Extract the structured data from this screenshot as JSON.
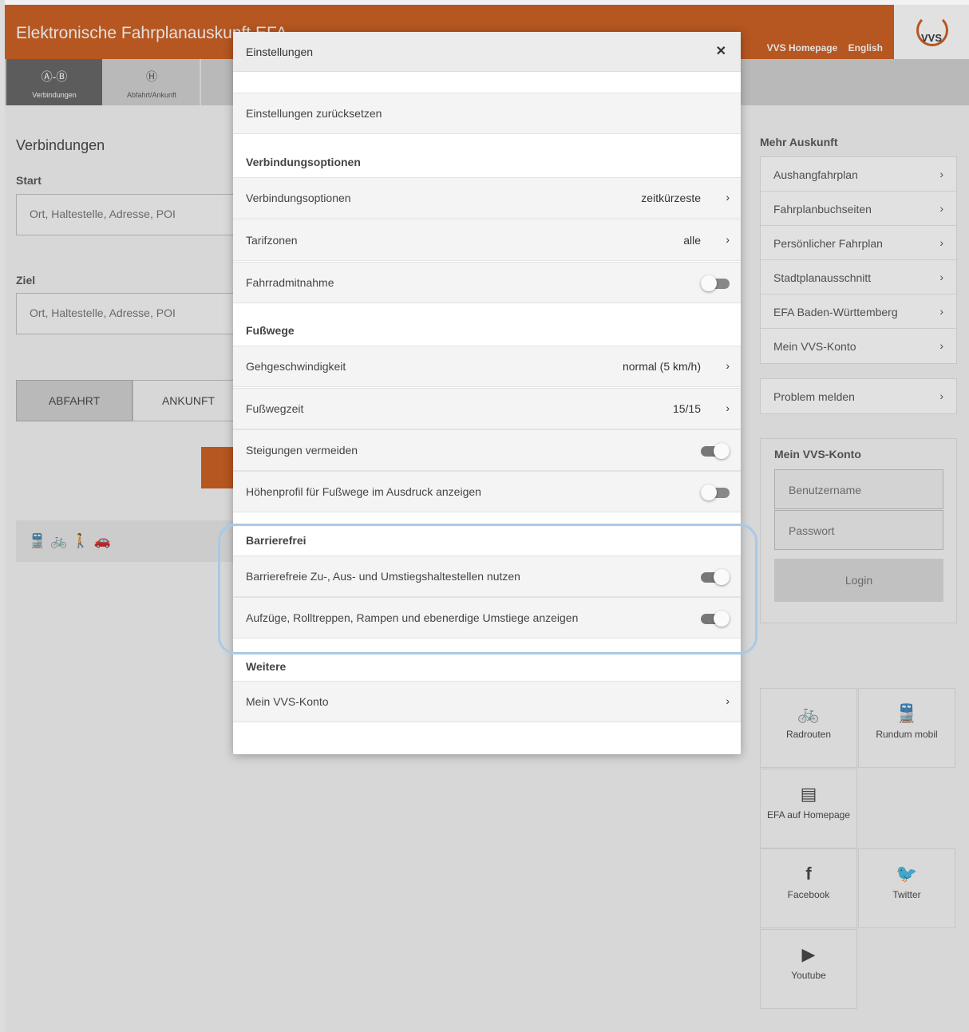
{
  "header": {
    "title": "Elektronische Fahrplanauskunft EFA",
    "links": [
      "VVS Homepage",
      "English"
    ],
    "logo": "VVS",
    "accent_color": "#c84e08"
  },
  "tabs": [
    {
      "label": "Verbindungen",
      "icon": "A-B"
    },
    {
      "label": "Abfahrt/Ankunft",
      "icon": "H"
    }
  ],
  "form": {
    "title": "Verbindungen",
    "start_label": "Start",
    "start_placeholder": "Ort, Haltestelle, Adresse, POI",
    "ziel_label": "Ziel",
    "ziel_placeholder": "Ort, Haltestelle, Adresse, POI",
    "abfahrt": "ABFAHRT",
    "ankunft": "ANKUNFT"
  },
  "sidebar": {
    "mehr_title": "Mehr Auskunft",
    "mehr_items": [
      "Aushangfahrplan",
      "Fahrplanbuchseiten",
      "Persönlicher Fahrplan",
      "Stadtplanausschnitt",
      "EFA Baden-Württemberg",
      "Mein VVS-Konto"
    ],
    "problem": "Problem melden",
    "konto_title": "Mein VVS-Konto",
    "username_placeholder": "Benutzername",
    "password_placeholder": "Passwort",
    "login": "Login",
    "tiles": {
      "radrouten": "Radrouten",
      "rundum": "Rundum mobil",
      "efa": "EFA auf Homepage",
      "facebook": "Facebook",
      "twitter": "Twitter",
      "youtube": "Youtube"
    }
  },
  "modal": {
    "title": "Einstellungen",
    "reset": "Einstellungen zurücksetzen",
    "sec_verbindung": "Verbindungsoptionen",
    "verbindungsoptionen": {
      "label": "Verbindungsoptionen",
      "value": "zeitkürzeste"
    },
    "tarifzonen": {
      "label": "Tarifzonen",
      "value": "alle"
    },
    "fahrrad": {
      "label": "Fahrradmitnahme",
      "on": false
    },
    "sec_fusswege": "Fußwege",
    "gehgeschwindigkeit": {
      "label": "Gehgeschwindigkeit",
      "value": "normal (5 km/h)"
    },
    "fusswegzeit": {
      "label": "Fußwegzeit",
      "value": "15/15"
    },
    "steigungen": {
      "label": "Steigungen vermeiden",
      "on": true
    },
    "hoehenprofil": {
      "label": "Höhenprofil für Fußwege im Ausdruck anzeigen",
      "on": false
    },
    "sec_barriere": "Barrierefrei",
    "barriere1": {
      "label": "Barrierefreie Zu-, Aus- und Umstiegshaltestellen nutzen",
      "on": true
    },
    "barriere2": {
      "label": "Aufzüge, Rolltreppen, Rampen und ebenerdige Umstiege anzeigen",
      "on": true
    },
    "sec_weitere": "Weitere",
    "konto": "Mein VVS-Konto"
  }
}
